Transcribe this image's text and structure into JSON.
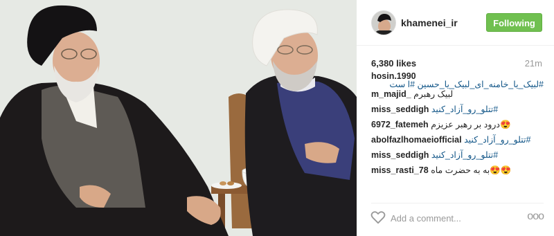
{
  "post": {
    "username": "khamenei_ir",
    "follow_label": "Following",
    "likes": "6,380 likes",
    "time": "21m"
  },
  "comments": [
    {
      "user": "hosin.1990",
      "text": "#لبیک_یا_خامنه_ای_لبیک_یا_حسین #ا ست"
    },
    {
      "user": "m_majid_",
      "text": "لبیک رهبرم"
    },
    {
      "user": "miss_seddigh",
      "text": "#تتلو_رو_آزاد_کنید"
    },
    {
      "user": "6972_fatemeh",
      "text": "😍درود بر رهبر عزیزم"
    },
    {
      "user": "abolfazlhomaeiofficial",
      "text": "#تتلو_رو_آزاد_کنید"
    },
    {
      "user": "miss_seddigh",
      "text": "#تتلو_رو_آزاد_کنید"
    },
    {
      "user": "miss_rasti_78",
      "text": "😍😍به به حضرت ماه"
    }
  ],
  "footer": {
    "placeholder": "Add a comment...",
    "more": "ooo"
  },
  "icons": {
    "like": "heart-outline-icon",
    "more": "more-options-icon"
  },
  "colors": {
    "follow_button": "#70c050",
    "hashtag": "#125688",
    "muted": "#999999"
  }
}
